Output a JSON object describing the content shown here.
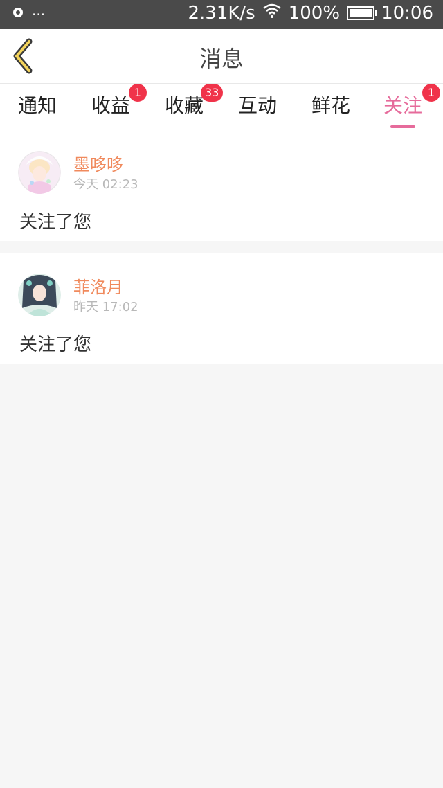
{
  "status_bar": {
    "net_speed": "2.31K/s",
    "battery_percent": "100%",
    "time": "10:06",
    "icons": [
      "notification-icon",
      "more-dots-icon",
      "wifi-icon",
      "battery-icon"
    ]
  },
  "header": {
    "title": "消息",
    "back_icon": "chevron-left-icon"
  },
  "tabs": [
    {
      "label": "通知",
      "badge": ""
    },
    {
      "label": "收益",
      "badge": "1"
    },
    {
      "label": "收藏",
      "badge": "33"
    },
    {
      "label": "互动",
      "badge": ""
    },
    {
      "label": "鲜花",
      "badge": ""
    },
    {
      "label": "关注",
      "badge": "1",
      "active": true
    }
  ],
  "colors": {
    "accent": "#e66b9b",
    "badge": "#f0334a",
    "username": "#f08a5d",
    "background": "#f6f6f6"
  },
  "messages": [
    {
      "username": "墨哆哆",
      "time": "今天 02:23",
      "text": "关注了您"
    },
    {
      "username": "菲洛月",
      "time": "昨天 17:02",
      "text": "关注了您"
    }
  ]
}
